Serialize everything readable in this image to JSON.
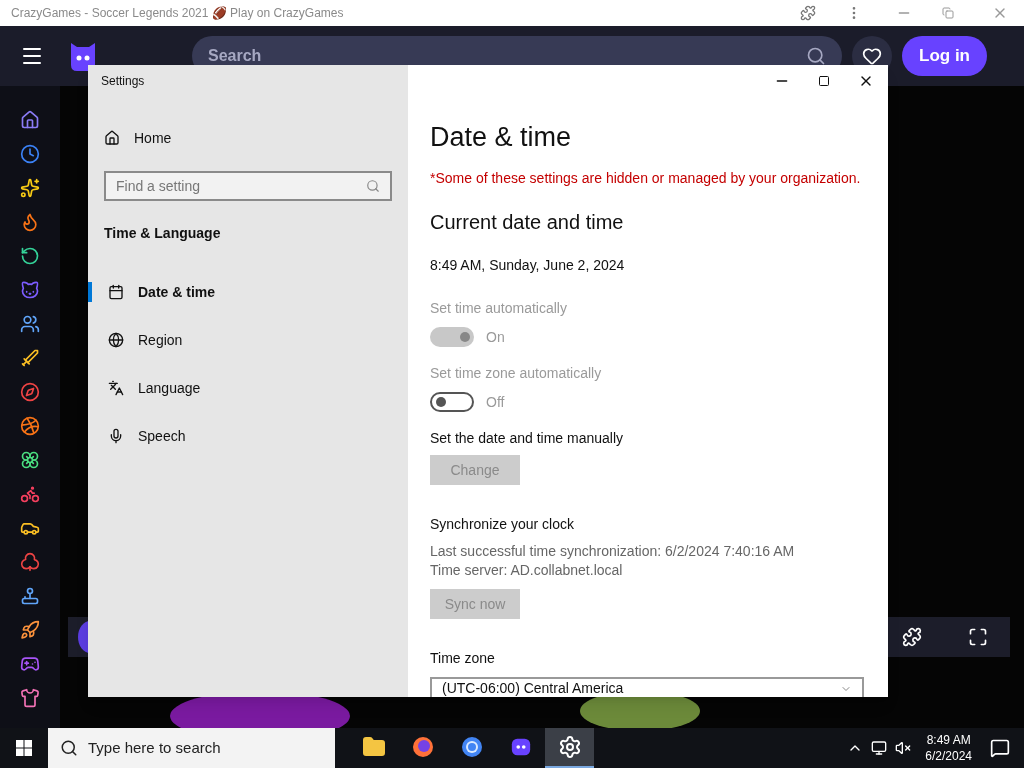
{
  "browser": {
    "title": "CrazyGames - Soccer Legends 2021 🏈 Play on CrazyGames"
  },
  "site": {
    "search_placeholder": "Search",
    "login": "Log in"
  },
  "settings": {
    "title": "Settings",
    "nav": {
      "home": "Home",
      "search_placeholder": "Find a setting",
      "section": "Time & Language",
      "items": [
        {
          "kind": "calendar",
          "label": "Date & time",
          "selected": true
        },
        {
          "kind": "globe",
          "label": "Region",
          "selected": false
        },
        {
          "kind": "language",
          "label": "Language",
          "selected": false
        },
        {
          "kind": "mic",
          "label": "Speech",
          "selected": false
        }
      ]
    },
    "page": {
      "title": "Date & time",
      "notice": "*Some of these settings are hidden or managed by your organization.",
      "section_title": "Current date and time",
      "current": "8:49 AM, Sunday, June 2, 2024",
      "toggles": [
        {
          "label": "Set time automatically",
          "on": true,
          "state_label": "On"
        },
        {
          "label": "Set time zone automatically",
          "on": false,
          "state_label": "Off"
        }
      ],
      "manual_label": "Set the date and time manually",
      "change_button": "Change",
      "sync_title": "Synchronize your clock",
      "sync_last": "Last successful time synchronization: 6/2/2024 7:40:16 AM",
      "sync_server": "Time server: AD.collabnet.local",
      "sync_button": "Sync now",
      "timezone_label": "Time zone",
      "timezone_value": "(UTC-06:00) Central America"
    }
  },
  "taskbar": {
    "search_placeholder": "Type here to search",
    "apps": [
      {
        "kind": "folder",
        "selected": false
      },
      {
        "kind": "firefox",
        "selected": false
      },
      {
        "kind": "chrome",
        "selected": false
      },
      {
        "kind": "crazygames",
        "selected": false
      },
      {
        "kind": "settings",
        "selected": true
      }
    ],
    "time": "8:49 AM",
    "date": "6/2/2024"
  }
}
